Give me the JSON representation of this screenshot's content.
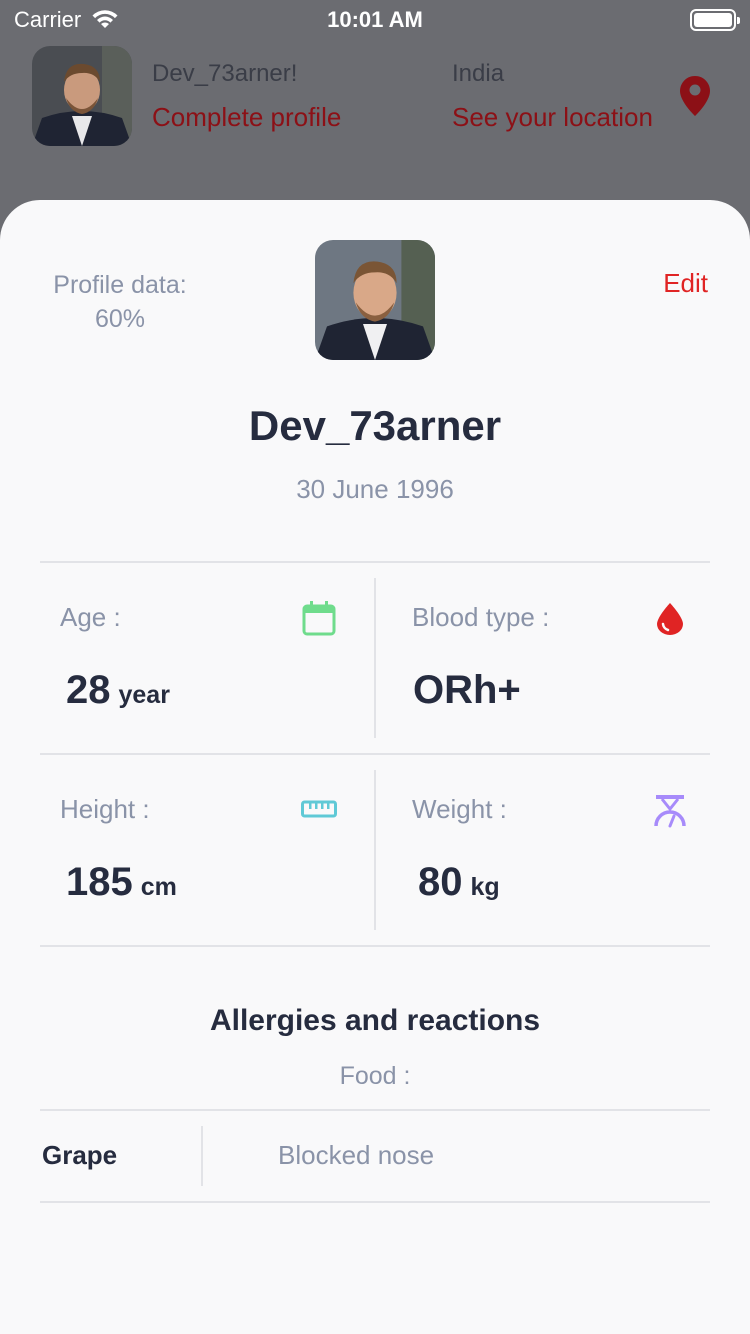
{
  "status_bar": {
    "carrier": "Carrier",
    "time": "10:01 AM"
  },
  "header": {
    "username": "Dev_73arner!",
    "complete_profile": "Complete profile",
    "country": "India",
    "see_location": "See your location"
  },
  "profile": {
    "data_label": "Profile data:",
    "data_percent": "60%",
    "edit": "Edit",
    "name": "Dev_73arner",
    "dob": "30 June 1996"
  },
  "stats": {
    "age": {
      "label": "Age :",
      "value": "28",
      "unit": "year"
    },
    "blood": {
      "label": "Blood type :",
      "value": "ORh+"
    },
    "height": {
      "label": "Height :",
      "value": "185",
      "unit": "cm"
    },
    "weight": {
      "label": "Weight :",
      "value": "80",
      "unit": "kg"
    }
  },
  "allergies": {
    "title": "Allergies and reactions",
    "category": "Food :",
    "items": [
      {
        "name": "Grape",
        "reaction": "Blocked nose"
      }
    ]
  },
  "colors": {
    "accent_red": "#e02424",
    "dark_red": "#8c1016",
    "age_icon": "#6fdc8c",
    "blood_icon": "#e02424",
    "height_icon": "#5fc9d6",
    "weight_icon": "#a78bfa"
  },
  "icons": {
    "location": "location-pin-icon",
    "age": "calendar-icon",
    "blood": "blood-drop-icon",
    "height": "ruler-icon",
    "weight": "scale-icon"
  }
}
